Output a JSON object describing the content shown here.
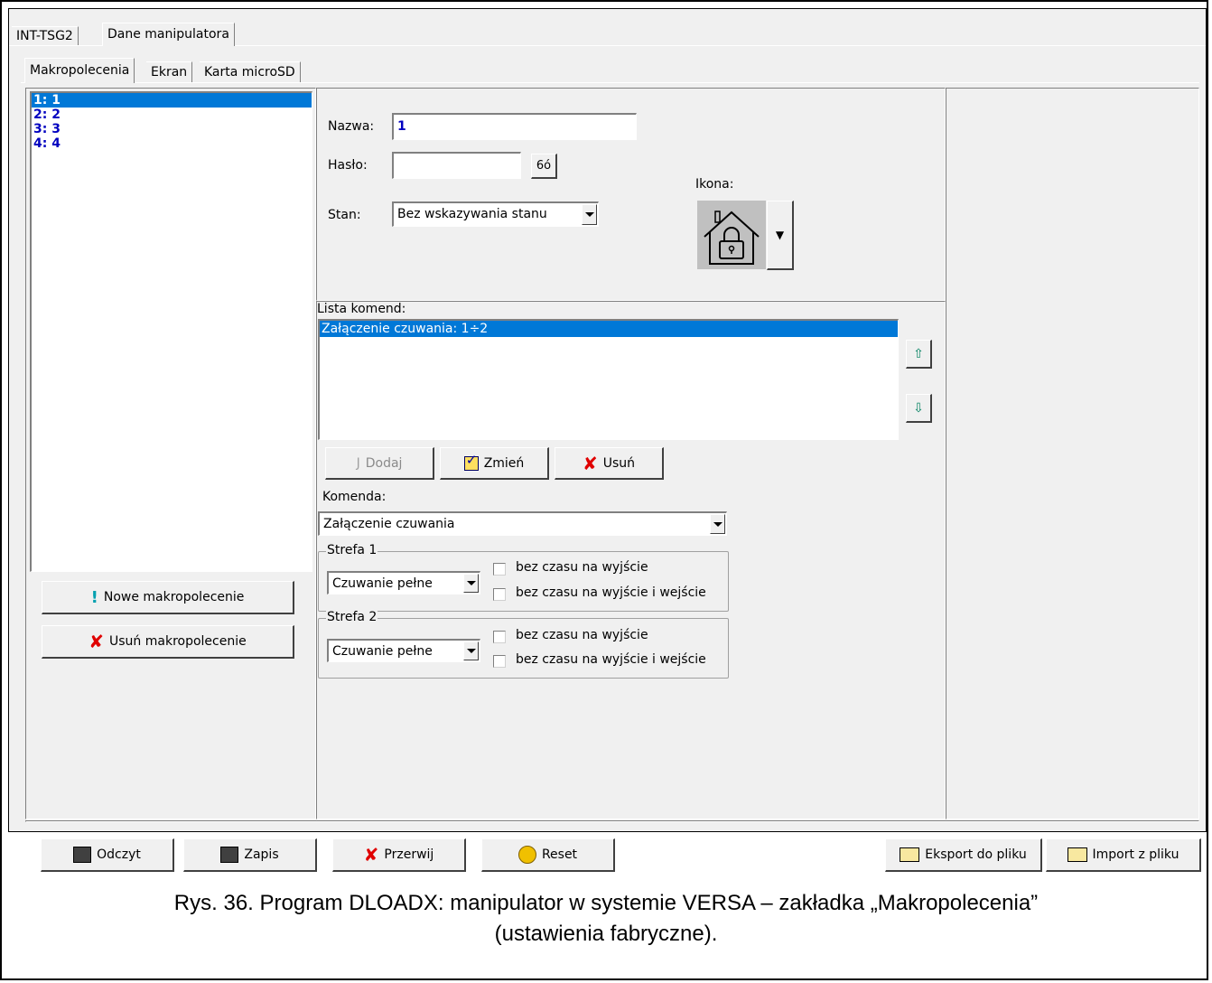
{
  "tabs_top": [
    "INT-TSG2",
    "Dane manipulatora"
  ],
  "tabs_sub": [
    "Makropolecenia",
    "Ekran",
    "Karta microSD"
  ],
  "macro_list": [
    "1: 1",
    "2: 2",
    "3: 3",
    "4: 4"
  ],
  "left_buttons": {
    "new": "Nowe makropolecenie",
    "delete": "Usuń makropolecenie"
  },
  "form": {
    "name_label": "Nazwa:",
    "name_value": "1",
    "password_label": "Hasło:",
    "password_value": "",
    "state_label": "Stan:",
    "state_value": "Bez wskazywania stanu",
    "icon_label": "Ikona:"
  },
  "commands": {
    "list_label": "Lista komend:",
    "items": [
      "Załączenie czuwania: 1÷2"
    ],
    "add": "Dodaj",
    "change": "Zmień",
    "remove": "Usuń",
    "command_label": "Komenda:",
    "command_value": "Załączenie czuwania"
  },
  "zones": [
    {
      "title": "Strefa 1",
      "mode": "Czuwanie pełne",
      "opt1": "bez czasu na wyjście",
      "opt2": "bez czasu na wyjście i wejście"
    },
    {
      "title": "Strefa 2",
      "mode": "Czuwanie pełne",
      "opt1": "bez czasu na wyjście",
      "opt2": "bez czasu na wyjście i wejście"
    }
  ],
  "bottom": {
    "read": "Odczyt",
    "write": "Zapis",
    "stop": "Przerwij",
    "reset": "Reset",
    "export": "Eksport do pliku",
    "import": "Import z pliku"
  },
  "caption": {
    "line1": "Rys. 36. Program DLOADX: manipulator w systemie VERSA – zakładka „Makropolecenia”",
    "line2": "(ustawienia fabryczne)."
  },
  "colors": {
    "selection": "#0078d7",
    "list_text": "#0000c0"
  }
}
